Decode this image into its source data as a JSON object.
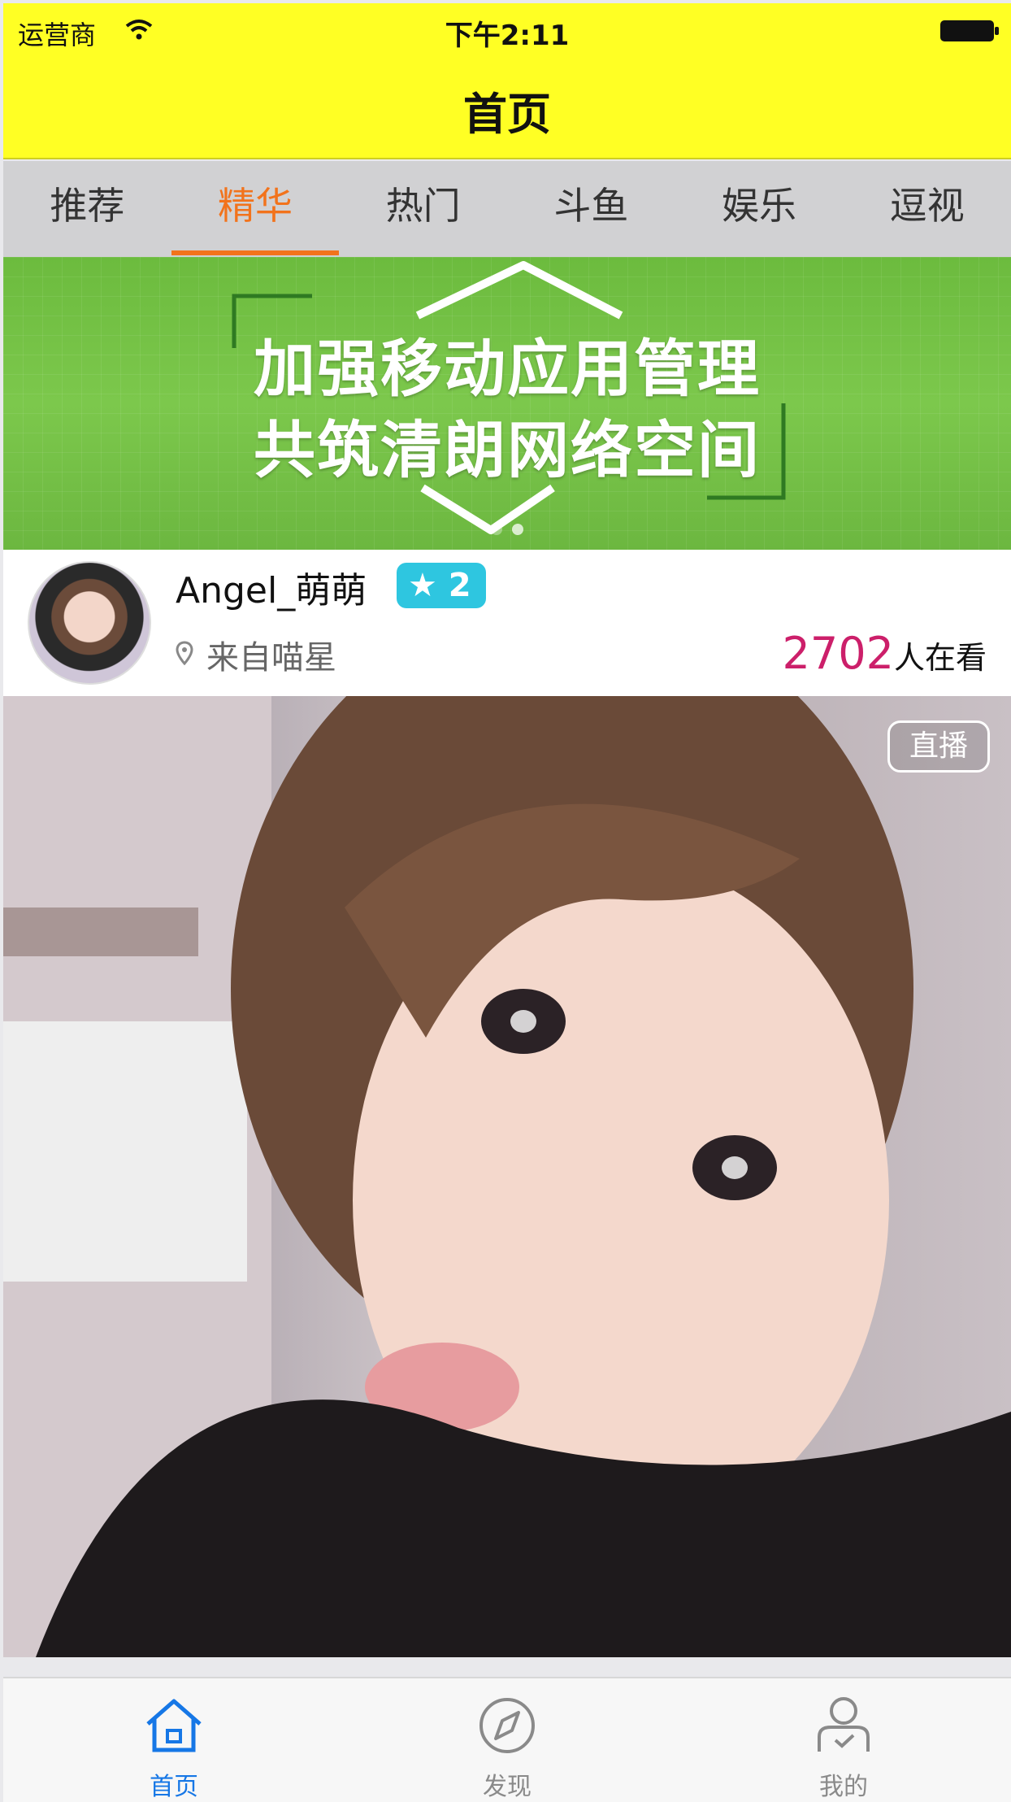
{
  "status_bar": {
    "carrier": "运营商",
    "time": "下午2:11"
  },
  "nav": {
    "title": "首页"
  },
  "tabs": [
    {
      "label": "推荐",
      "active": false
    },
    {
      "label": "精华",
      "active": true
    },
    {
      "label": "热门",
      "active": false
    },
    {
      "label": "斗鱼",
      "active": false
    },
    {
      "label": "娱乐",
      "active": false
    },
    {
      "label": "逗视",
      "active": false
    }
  ],
  "banner": {
    "line1": "加强移动应用管理",
    "line2": "共筑清朗网络空间"
  },
  "live_card": {
    "username": "Angel_萌萌",
    "level": "2",
    "location": "来自喵星",
    "viewer_count": "2702",
    "viewer_suffix": "人在看",
    "live_badge": "直播"
  },
  "tab_bar": [
    {
      "label": "首页",
      "icon": "home-icon",
      "active": true
    },
    {
      "label": "发现",
      "icon": "compass-icon",
      "active": false
    },
    {
      "label": "我的",
      "icon": "person-icon",
      "active": false
    }
  ],
  "colors": {
    "nav_bg": "#ffff24",
    "tab_active": "#f2731c",
    "viewer_count": "#cc1f6a",
    "level_badge": "#2ec6e0",
    "tabbar_active": "#1677e6"
  }
}
